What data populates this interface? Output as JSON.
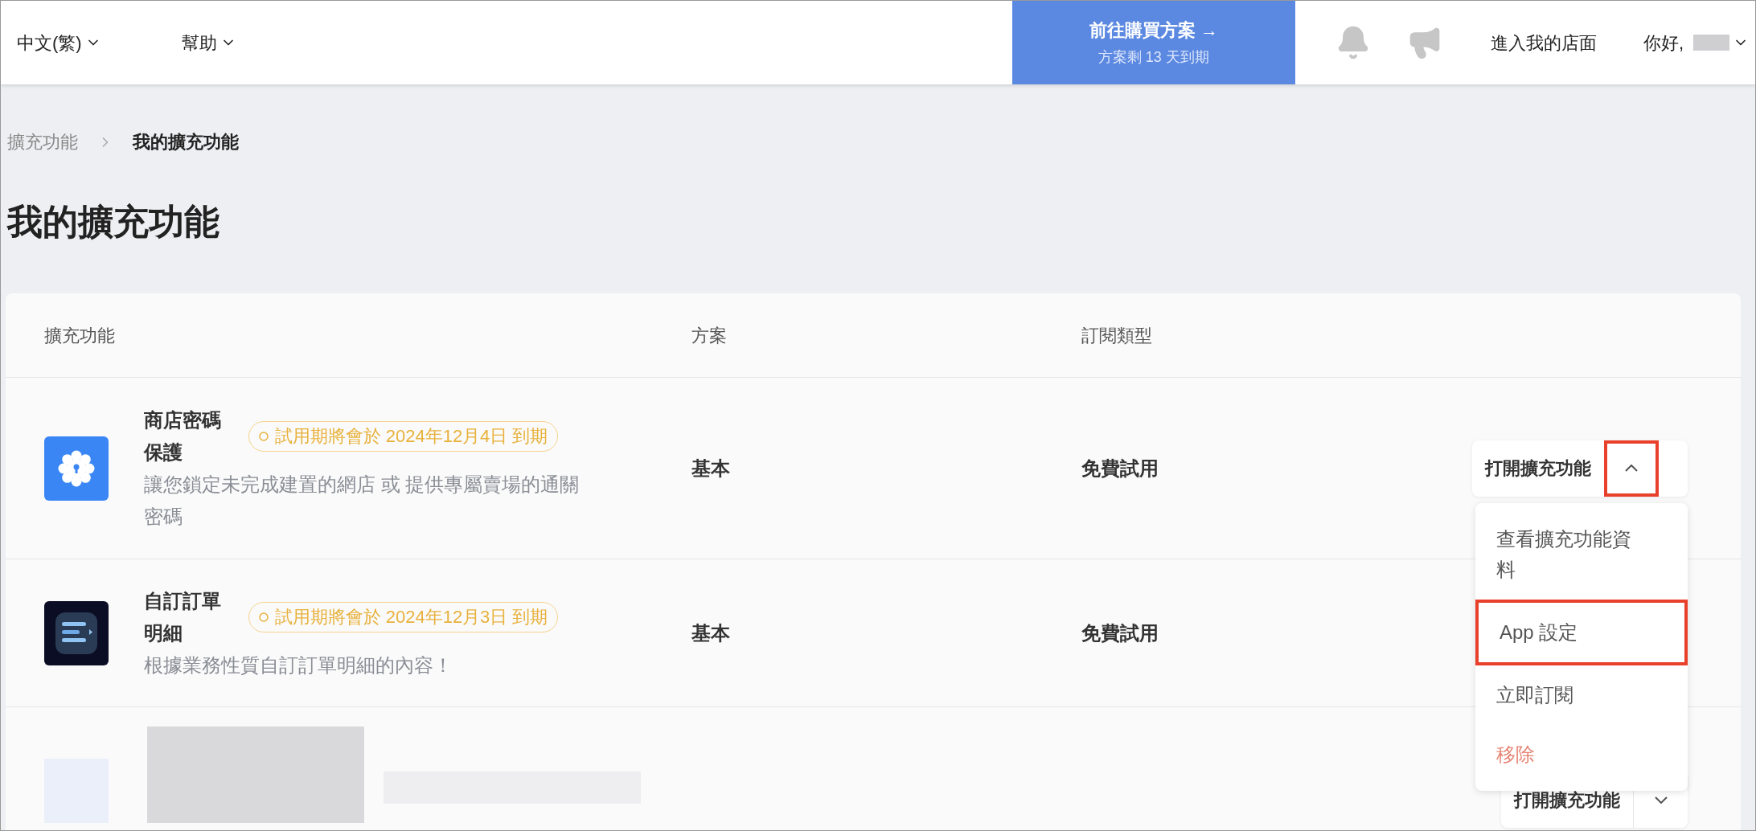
{
  "top_bar": {
    "language": "中文(繁)",
    "help": "幫助",
    "upgrade": {
      "title": "前往購買方案 →",
      "subtitle": "方案剩 13 天到期"
    },
    "storefront": "進入我的店面",
    "greeting": "你好,"
  },
  "breadcrumb": [
    {
      "label": "擴充功能",
      "current": false
    },
    {
      "label": "我的擴充功能",
      "current": true
    }
  ],
  "page_title": "我的擴充功能",
  "table": {
    "columns": [
      "擴充功能",
      "方案",
      "訂閱類型"
    ],
    "rows": [
      {
        "kind": "app",
        "name": "商店密碼保護",
        "badge": "試用期將會於 2024年12月4日 到期",
        "description": "讓您鎖定未完成建置的網店 或 提供專屬賣場的通關密碼",
        "plan": "基本",
        "subscription_type": "免費試用",
        "action": {
          "label": "打開擴充功能",
          "expanded": true,
          "highlighted": true
        }
      },
      {
        "kind": "app",
        "name": "自訂訂單明細",
        "badge": "試用期將會於 2024年12月3日 到期",
        "description": "根據業務性質自訂訂單明細的內容！",
        "plan": "基本",
        "subscription_type": "免費試用"
      },
      {
        "kind": "redacted",
        "action": {
          "label": "打開擴充功能",
          "expanded": false,
          "highlighted": false
        }
      }
    ]
  },
  "action_menu": [
    {
      "label": "查看擴充功能資料",
      "kind": "normal",
      "highlighted": false
    },
    {
      "label": "App 設定",
      "kind": "normal",
      "highlighted": true
    },
    {
      "label": "立即訂閱",
      "kind": "normal",
      "highlighted": false
    },
    {
      "label": "移除",
      "kind": "danger",
      "highlighted": false
    }
  ]
}
